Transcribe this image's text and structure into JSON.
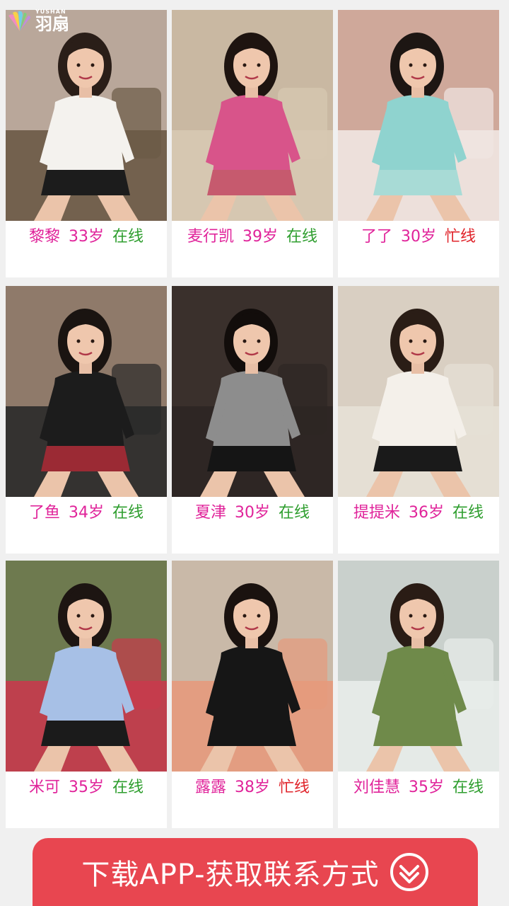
{
  "brand": {
    "sub_label": "YUSHAN",
    "name": "羽扇"
  },
  "profiles": [
    {
      "name": "黎黎",
      "age": "33岁",
      "status": "在线",
      "status_color": "#2e9e2e",
      "photo": {
        "bg": "#b9a79a",
        "shirt": "#f4f2ee",
        "hair": "#2a1e18",
        "skirt": "#1c1c1c",
        "seat": "#6b5a46"
      }
    },
    {
      "name": "麦行凯",
      "age": "39岁",
      "status": "在线",
      "status_color": "#2e9e2e",
      "photo": {
        "bg": "#c9b8a2",
        "shirt": "#d8548a",
        "hair": "#1e1410",
        "skirt": "#c65a6e",
        "seat": "#d7c9b2"
      }
    },
    {
      "name": "了了",
      "age": "30岁",
      "status": "忙线",
      "status_color": "#e0232a",
      "photo": {
        "bg": "#cfa89a",
        "shirt": "#8fd3cf",
        "hair": "#1d1613",
        "skirt": "#a8dbd6",
        "seat": "#f0e6e2"
      }
    },
    {
      "name": "了鱼",
      "age": "34岁",
      "status": "在线",
      "status_color": "#2e9e2e",
      "photo": {
        "bg": "#8f7a6a",
        "shirt": "#1c1c1c",
        "hair": "#1a1411",
        "skirt": "#9b2a34",
        "seat": "#2a2a2a"
      }
    },
    {
      "name": "夏津",
      "age": "30岁",
      "status": "在线",
      "status_color": "#2e9e2e",
      "photo": {
        "bg": "#3a302c",
        "shirt": "#8d8d8d",
        "hair": "#120d0b",
        "skirt": "#151515",
        "seat": "#2e2624"
      }
    },
    {
      "name": "提提米",
      "age": "36岁",
      "status": "在线",
      "status_color": "#2e9e2e",
      "photo": {
        "bg": "#d9cfc2",
        "shirt": "#f4f0ea",
        "hair": "#2a1d16",
        "skirt": "#1a1a1a",
        "seat": "#e6e0d6"
      }
    },
    {
      "name": "米可",
      "age": "35岁",
      "status": "在线",
      "status_color": "#2e9e2e",
      "photo": {
        "bg": "#6e7a4f",
        "shirt": "#a7c0e6",
        "hair": "#1d1512",
        "skirt": "#1b1b1b",
        "seat": "#c73a4c"
      }
    },
    {
      "name": "露露",
      "age": "38岁",
      "status": "忙线",
      "status_color": "#e0232a",
      "photo": {
        "bg": "#c9b9a8",
        "shirt": "#161616",
        "hair": "#1a120f",
        "skirt": "#161616",
        "seat": "#e59a7c"
      }
    },
    {
      "name": "刘佳慧",
      "age": "35岁",
      "status": "在线",
      "status_color": "#2e9e2e",
      "photo": {
        "bg": "#c9d0cc",
        "shirt": "#6f8a4a",
        "hair": "#2a1c15",
        "skirt": "#6f8a4a",
        "seat": "#e8ecea"
      }
    }
  ],
  "cta": {
    "label": "下载APP-获取联系方式",
    "icon": "double-chevron-down-icon",
    "color": "#e84650"
  }
}
